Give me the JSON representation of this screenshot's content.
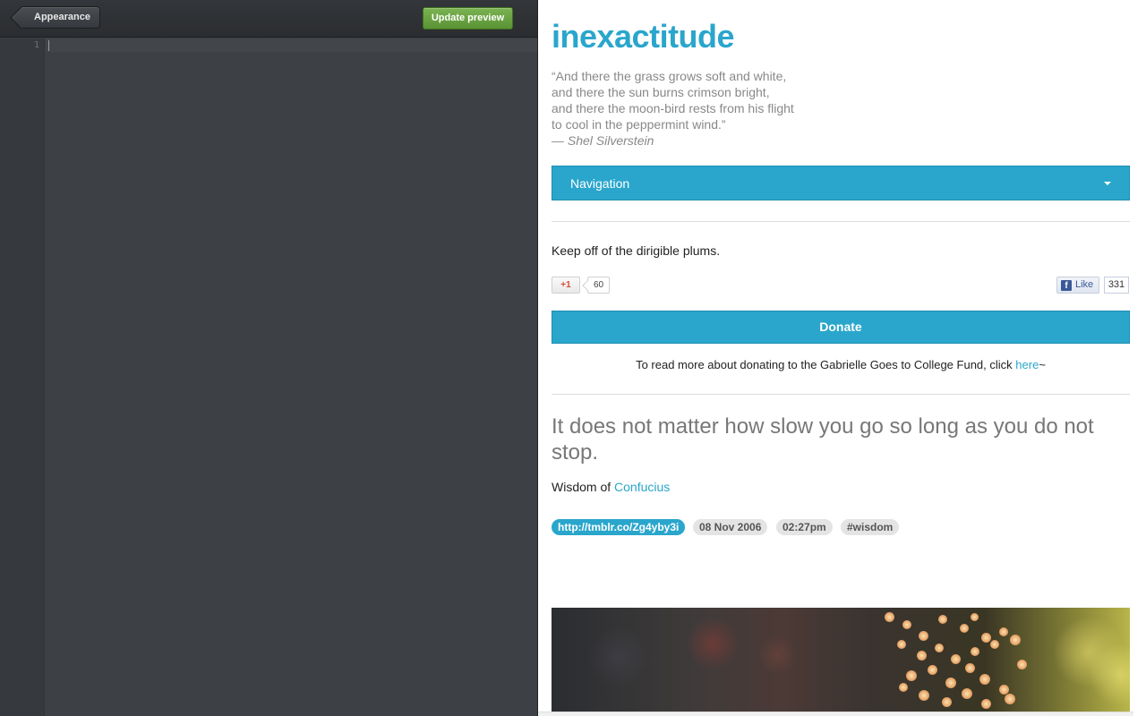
{
  "editor": {
    "back_label": "Appearance",
    "update_label": "Update preview",
    "line_number": "1"
  },
  "blog": {
    "title": "inexactitude",
    "quote_lines": [
      "“And there the grass grows soft and white,",
      "and there the sun burns crimson bright,",
      "and there the moon-bird rests from his flight",
      "to cool in the peppermint wind.”"
    ],
    "quote_source": "— Shel Silverstein",
    "nav_label": "Navigation",
    "description": "Keep off of the dirigible plums.",
    "gplus_label": "+1",
    "gplus_count": "60",
    "fb_label": "Like",
    "fb_count": "331",
    "donate_label": "Donate",
    "donate_text": "To read more about donating to the Gabrielle Goes to College Fund, click ",
    "donate_link": "here",
    "donate_suffix": "~"
  },
  "post": {
    "quote": "It does not matter how slow you go so long as you do not stop.",
    "source_prefix": "Wisdom of ",
    "source_link": "Confucius",
    "tags": {
      "link": "http://tmblr.co/Zg4yby3i",
      "date": "08 Nov 2006",
      "time": "02:27pm",
      "hashtag": "#wisdom"
    }
  },
  "colors": {
    "accent": "#2aa6cc",
    "update_button": "#6aa342",
    "editor_bg": "#3d4044"
  },
  "icons": [
    "back-arrow-icon",
    "caret-down-icon",
    "google-plus-icon",
    "facebook-icon"
  ]
}
